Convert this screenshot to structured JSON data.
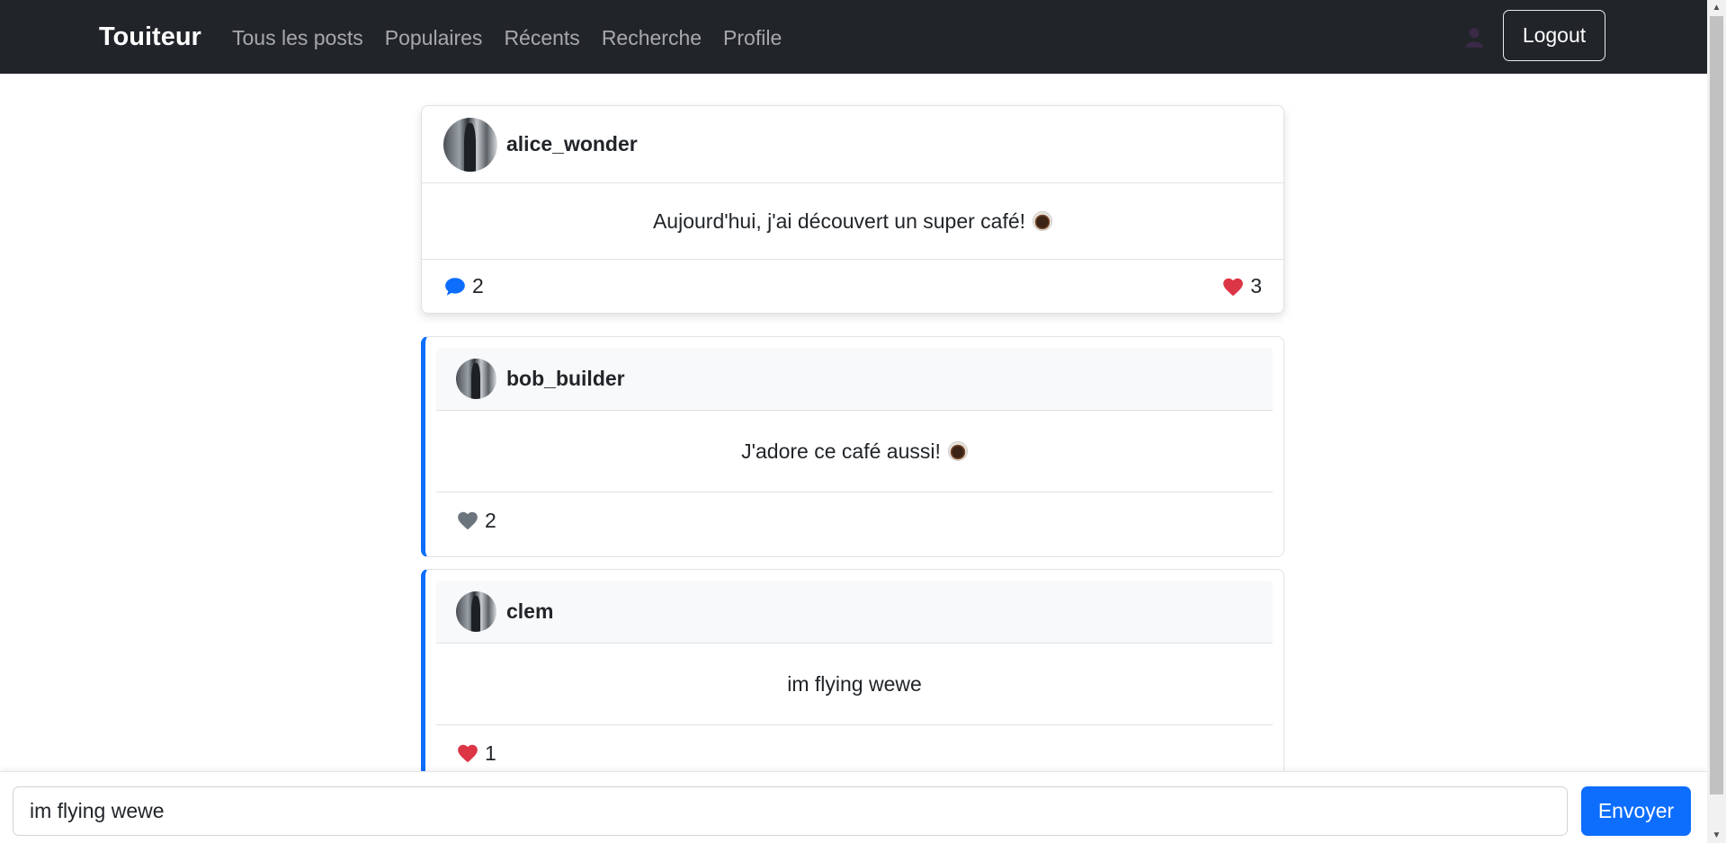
{
  "navbar": {
    "brand": "Touiteur",
    "links": [
      "Tous les posts",
      "Populaires",
      "Récents",
      "Recherche",
      "Profile"
    ],
    "user_icon": "user-icon",
    "logout_label": "Logout"
  },
  "post": {
    "username": "alice_wonder",
    "content": "Aujourd'hui, j'ai découvert un super café!",
    "comments_count": "2",
    "likes_count": "3",
    "comment_icon": "comment-icon",
    "like_icon": "heart-icon"
  },
  "replies": [
    {
      "username": "bob_builder",
      "content": "J'adore ce café aussi!",
      "likes_count": "2",
      "liked": false
    },
    {
      "username": "clem",
      "content": "im flying wewe",
      "likes_count": "1",
      "liked": true
    }
  ],
  "compose": {
    "value": "im flying wewe",
    "send_label": "Envoyer"
  },
  "colors": {
    "navbar_bg": "#212529",
    "accent": "#0d6efd",
    "like_active": "#dc3545",
    "like_inactive": "#6c757d"
  }
}
